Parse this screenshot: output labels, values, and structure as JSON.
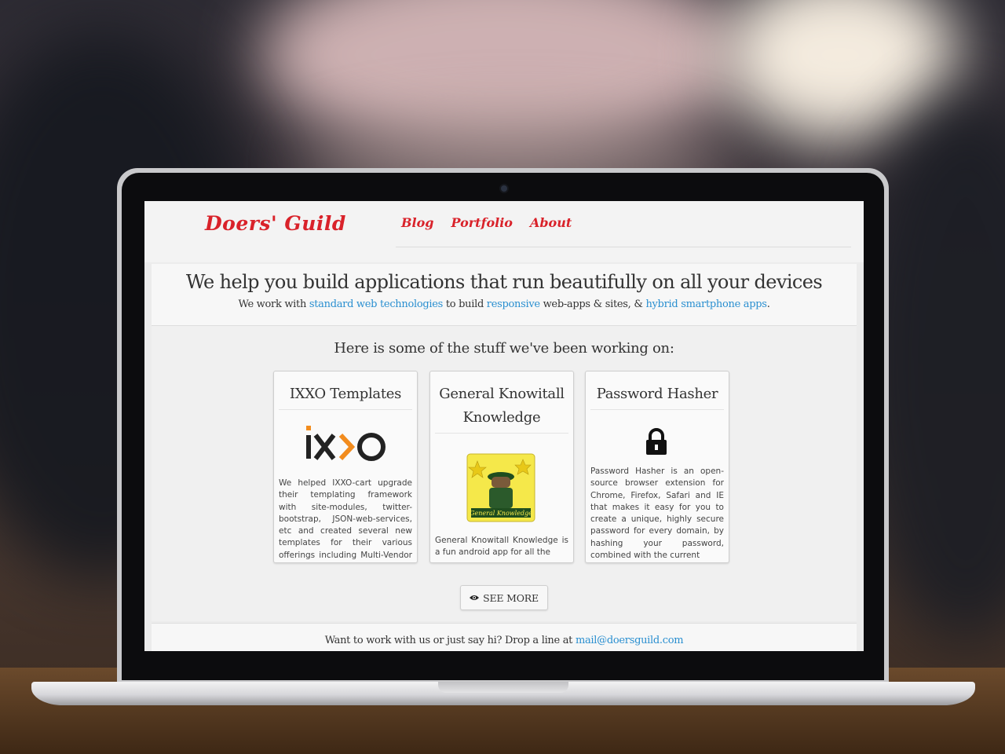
{
  "site": {
    "logo": "Doers' Guild",
    "nav": [
      "Blog",
      "Portfolio",
      "About"
    ]
  },
  "hero": {
    "headline": "We help you build applications that run beautifully on all your devices",
    "intro_prefix": "We work with ",
    "link_web": "standard web technologies",
    "intro_mid1": " to build ",
    "link_responsive": "responsive",
    "intro_mid2": " web-apps & sites, & ",
    "link_hybrid": "hybrid smartphone apps",
    "intro_suffix": "."
  },
  "work": {
    "heading": "Here is some of the stuff we've been working on:",
    "cards": [
      {
        "title": "IXXO Templates",
        "logo_text": "IX>O",
        "description": "We helped IXXO-cart upgrade their templating framework with site-modules, twitter-bootstrap, JSON-web-services, etc and created several new templates for their various offerings including Multi-Vendor cart,"
      },
      {
        "title": "General Knowitall Knowledge",
        "logo_text": "General Knowledge",
        "description": "General Knowitall Knowledge is a fun android app for all the"
      },
      {
        "title": "Password Hasher",
        "icon": "lock-icon",
        "description": "Password Hasher is an open-source browser extension for Chrome, Firefox, Safari and IE that makes it easy for you to create a unique, highly secure password for every domain, by hashing your password, combined with the current"
      }
    ],
    "see_more": "SEE MORE"
  },
  "footer": {
    "text": "Want to work with us or just say hi? Drop a line at ",
    "email": "mail@doersguild.com"
  },
  "colors": {
    "brand_red": "#d9222a",
    "link_blue": "#2a8fd0"
  }
}
